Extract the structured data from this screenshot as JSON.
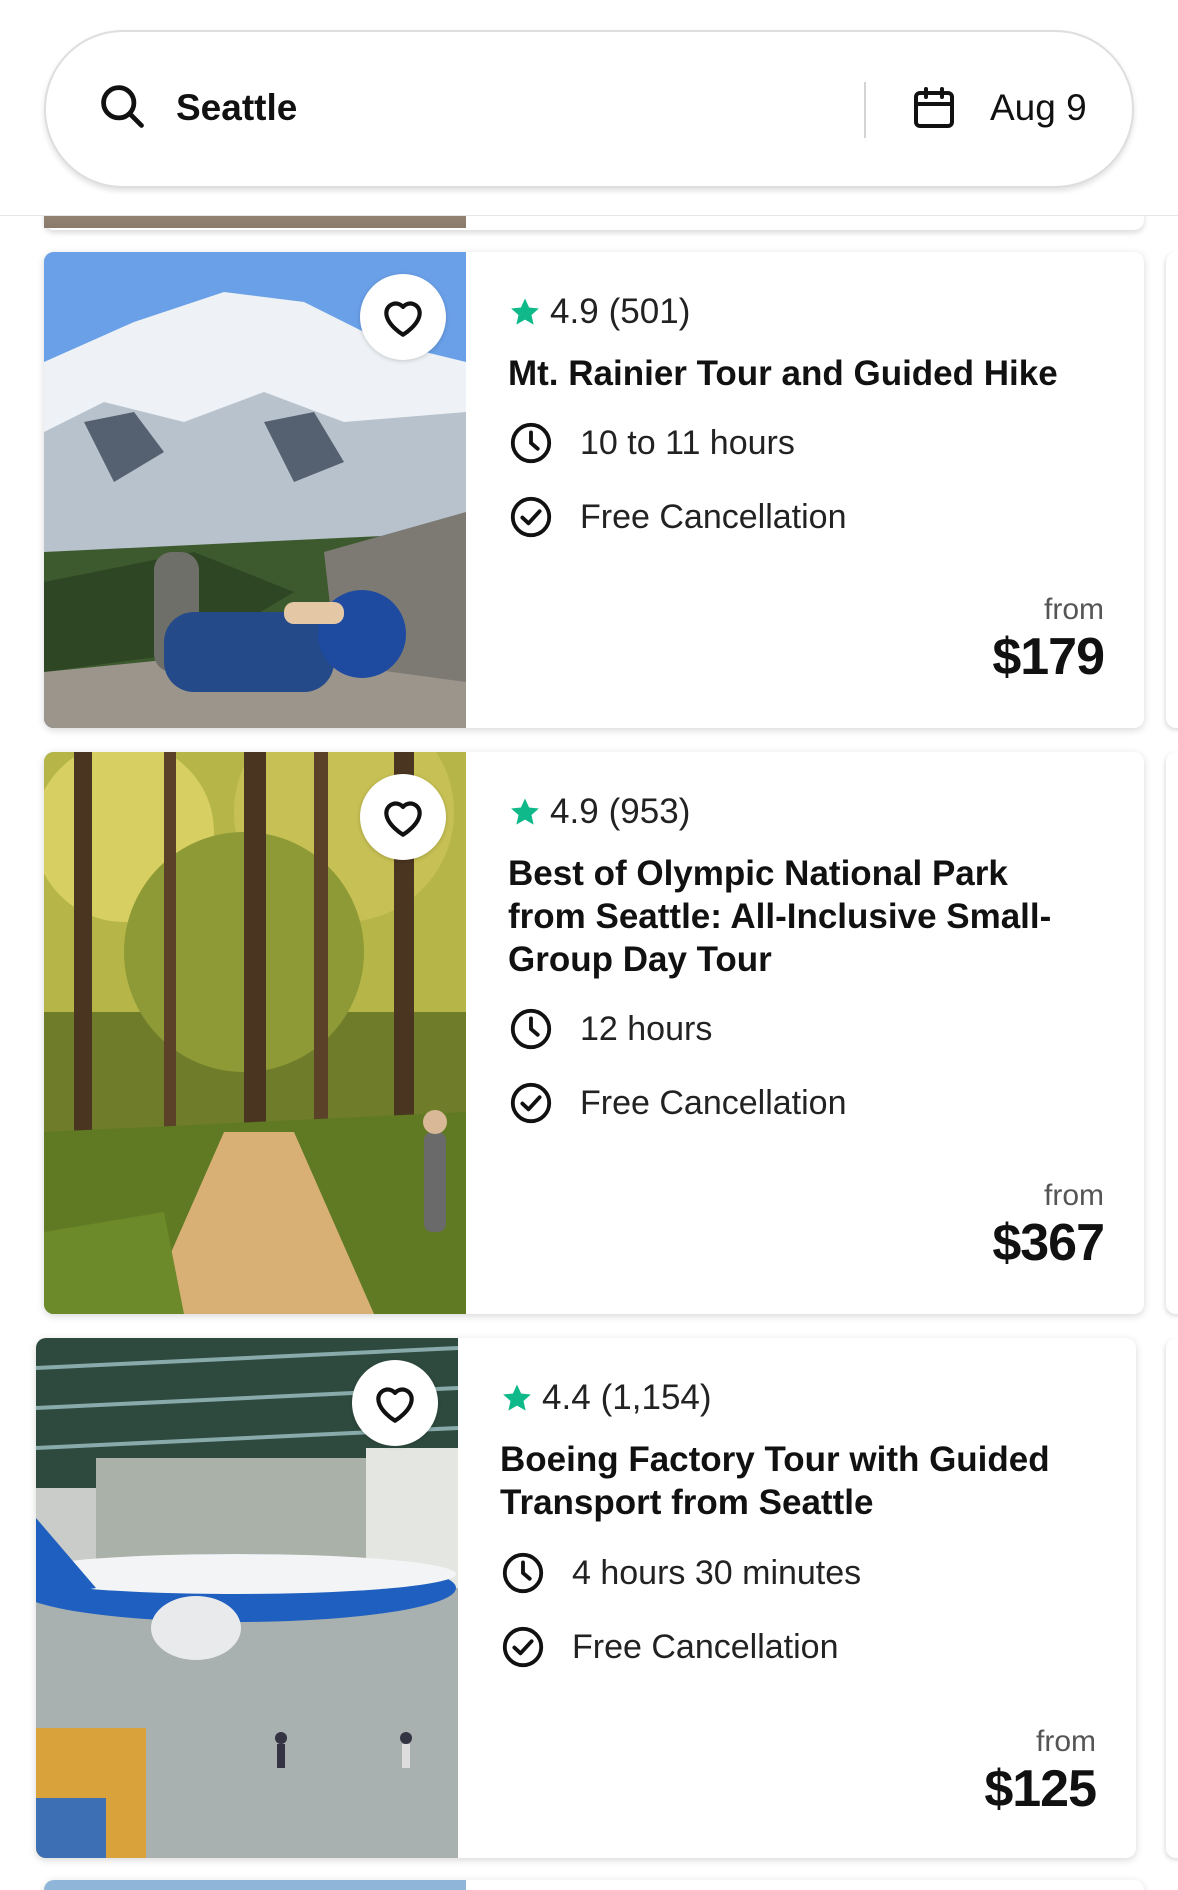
{
  "search": {
    "location": "Seattle",
    "date": "Aug 9"
  },
  "colors": {
    "star": "#10b98a",
    "text": "#111111"
  },
  "listings": [
    {
      "rating": "4.9",
      "reviews": "(501)",
      "title": "Mt. Rainier Tour and Guided Hike",
      "duration": "10 to 11 hours",
      "cancellation": "Free Cancellation",
      "from_label": "from",
      "price": "$179"
    },
    {
      "rating": "4.9",
      "reviews": "(953)",
      "title": "Best of Olympic National Park from Seattle: All-Inclusive Small-Group Day Tour",
      "duration": "12 hours",
      "cancellation": "Free Cancellation",
      "from_label": "from",
      "price": "$367"
    },
    {
      "rating": "4.4",
      "reviews": "(1,154)",
      "title": "Boeing Factory Tour with Guided Transport from Seattle",
      "duration": "4 hours 30 minutes",
      "cancellation": "Free Cancellation",
      "from_label": "from",
      "price": "$125"
    }
  ]
}
